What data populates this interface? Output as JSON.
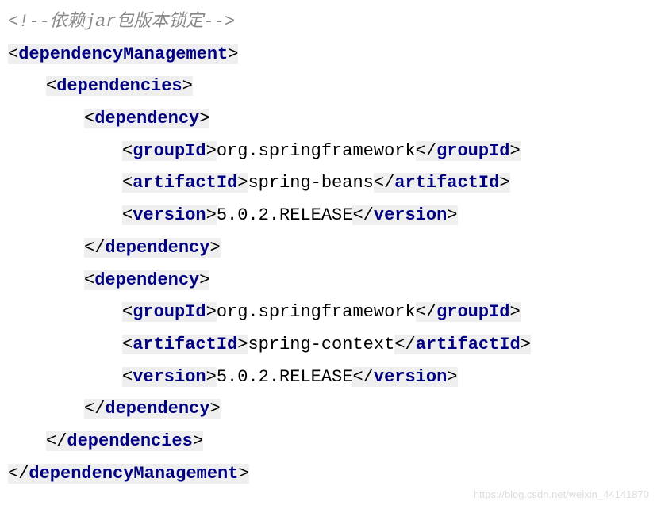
{
  "comment": "<!--依赖jar包版本锁定-->",
  "tags": {
    "dependencyManagement": "dependencyManagement",
    "dependencies": "dependencies",
    "dependency": "dependency",
    "groupId": "groupId",
    "artifactId": "artifactId",
    "version": "version"
  },
  "deps": [
    {
      "groupId": "org.springframework",
      "artifactId": "spring-beans",
      "version": "5.0.2.RELEASE"
    },
    {
      "groupId": "org.springframework",
      "artifactId": "spring-context",
      "version": "5.0.2.RELEASE"
    }
  ],
  "watermark": "https://blog.csdn.net/weixin_44141870"
}
